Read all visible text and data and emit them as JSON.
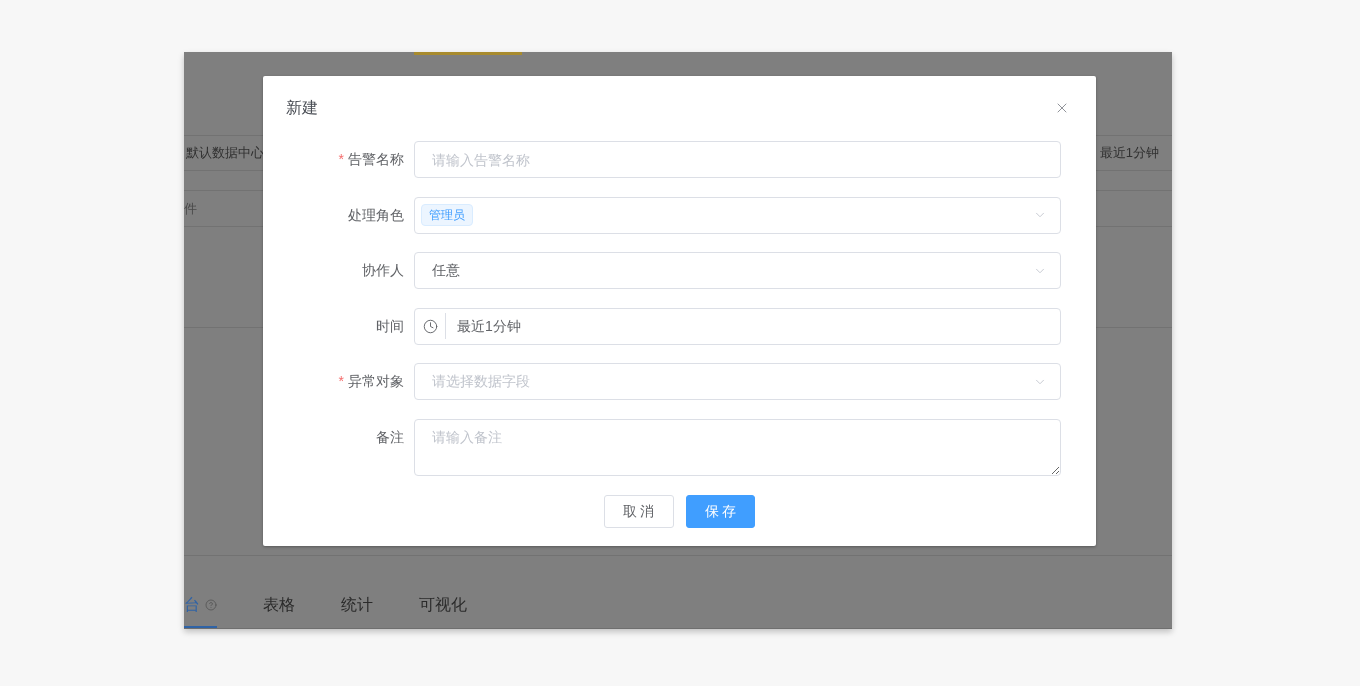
{
  "background": {
    "filter_row": {
      "column_1": "默认数据中心",
      "column_2": "最近1分钟"
    },
    "condition_row": {
      "column_1": "件"
    },
    "tabs": [
      {
        "label": "台",
        "selected": true,
        "help": true
      },
      {
        "label": "表格",
        "selected": false,
        "help": false
      },
      {
        "label": "统计",
        "selected": false,
        "help": false
      },
      {
        "label": "可视化",
        "selected": false,
        "help": false
      }
    ]
  },
  "dialog": {
    "title": "新建",
    "fields": [
      {
        "label": "告警名称",
        "marker": "*",
        "kind": "text",
        "placeholder": "请输入告警名称"
      },
      {
        "label": "处理角色",
        "kind": "select",
        "tags": [
          "管理员"
        ]
      },
      {
        "label": "协作人",
        "kind": "select",
        "value": "任意"
      },
      {
        "label": "时间",
        "kind": "time",
        "value": "最近1分钟"
      },
      {
        "label": "异常对象",
        "marker": "*",
        "kind": "select",
        "placeholder": "请选择数据字段"
      },
      {
        "label": "备注",
        "kind": "textarea",
        "placeholder": "请输入备注"
      }
    ],
    "buttons": [
      {
        "label": "取 消",
        "kind": "default"
      },
      {
        "label": "保 存",
        "kind": "primary"
      }
    ]
  }
}
